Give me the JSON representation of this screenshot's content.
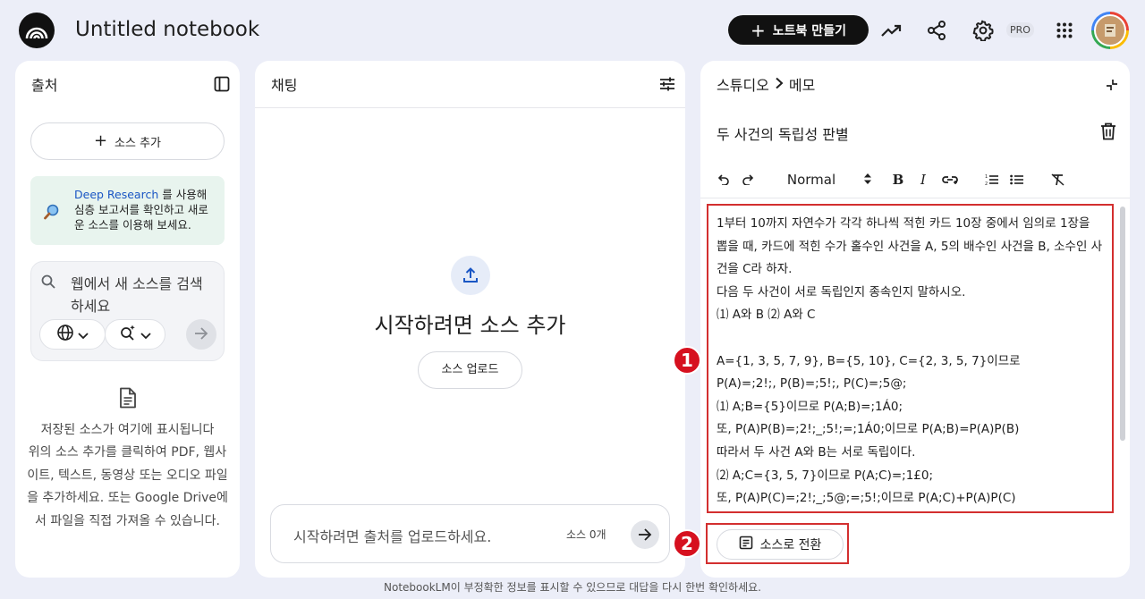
{
  "header": {
    "title": "Untitled notebook",
    "new_notebook_label": "노트북 만들기",
    "pro_badge": "PRO"
  },
  "sources": {
    "title": "출처",
    "add_source_label": "소스 추가",
    "deep_research": {
      "link": "Deep Research",
      "text": " 를 사용해 심층 보고서를 확인하고 새로운 소스를 이용해 보세요."
    },
    "search_placeholder": "웹에서 새 소스를 검색하세요",
    "empty_title": "저장된 소스가 여기에 표시됩니다",
    "empty_body": "위의 소스 추가를 클릭하여 PDF, 웹사이트, 텍스트, 동영상 또는 오디오 파일을 추가하세요. 또는 Google Drive에서 파일을 직접 가져올 수 있습니다."
  },
  "chat": {
    "title": "채팅",
    "heading": "시작하려면 소스 추가",
    "upload_label": "소스 업로드",
    "input_placeholder": "시작하려면 출처를 업로드하세요.",
    "source_count": "소스 0개"
  },
  "studio": {
    "breadcrumb_root": "스튜디오",
    "breadcrumb_current": "메모",
    "memo_title": "두 사건의 독립성 판별",
    "format_select": "Normal",
    "content_lines": [
      "1부터 10까지 자연수가 각각 하나씩 적힌 카드 10장 중에서 임의로 1장을 뽑을 때, 카드에 적힌 수가 홀수인 사건을 A, 5의 배수인 사건을 B, 소수인 사건을 C라 하자.",
      "다음 두 사건이 서로 독립인지 종속인지 말하시오.",
      "⑴ A와 B ⑵ A와 C",
      "",
      "A={1, 3, 5, 7, 9}, B={5, 10}, C={2, 3, 5, 7}이므로",
      "P(A)=;2!;, P(B)=;5!;, P(C)=;5@;",
      "⑴ A;B={5}이므로 P(A;B)=;1Á0;",
      "또, P(A)P(B)=;2!;_;5!;=;1Á0;이므로 P(A;B)=P(A)P(B)",
      "따라서 두 사건 A와 B는 서로 독립이다.",
      "⑵ A;C={3, 5, 7}이므로 P(A;C)=;1£0;",
      "또, P(A)P(C)=;2!;_;5@;=;5!;이므로 P(A;C)+P(A)P(C)"
    ],
    "convert_label": "소스로 전환"
  },
  "annotations": {
    "marker_1": "1",
    "marker_2": "2"
  },
  "footer": {
    "disclaimer": "NotebookLM이 부정확한 정보를 표시할 수 있으므로 대답을 다시 한번 확인하세요."
  }
}
